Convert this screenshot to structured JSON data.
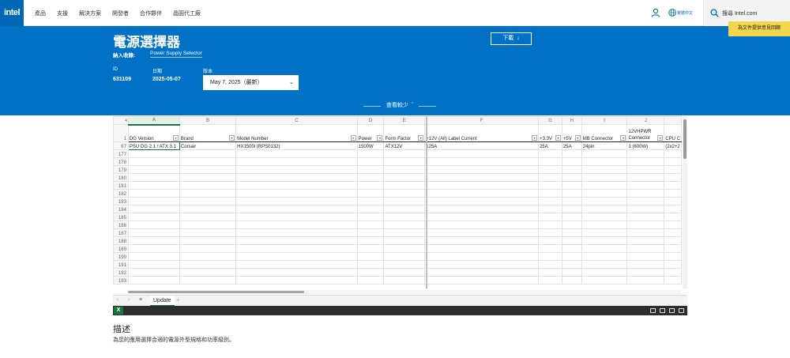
{
  "nav": {
    "logo": "intel",
    "links": [
      "產品",
      "支援",
      "解決方案",
      "開發者",
      "合作夥伴",
      "晶圓代工廠"
    ],
    "language": "繁體中文",
    "search_placeholder": "搜尋 Intel.com"
  },
  "hero": {
    "title": "電源選擇器",
    "included_label": "納入收錄:",
    "included_link": "Power Supply Selector",
    "id_label": "ID",
    "id_value": "631109",
    "date_label": "日期",
    "date_value": "2025-05-07",
    "version_label": "版本",
    "version_value": "May 7, 2025（最新）",
    "download_label": "下載",
    "feedback_label": "為文件提供意見回饋",
    "collapse_label": "查看較少"
  },
  "spreadsheet": {
    "corner": "4",
    "columns": [
      "A",
      "B",
      "C",
      "D",
      "E",
      "F",
      "G",
      "H",
      "I",
      "J",
      ""
    ],
    "header_row_number": "1",
    "headers": [
      "DG Version",
      "Brand",
      "Model Number",
      "Power",
      "Form Factor",
      "+12V (All) Label Current",
      "+3.3V",
      "+5V",
      "MB Connector",
      "12VHPWR Connector",
      "CPU C"
    ],
    "data_row_number": "67",
    "data_row": [
      "PSU DG 2.1 / ATX 3.1",
      "Corsair",
      "HX1500i (RPS0132)",
      "1500W",
      "ATX12V",
      "125A",
      "25A",
      "25A",
      "24pin",
      "1 (600W)",
      "(2x2+2"
    ],
    "empty_row_numbers": [
      "177",
      "178",
      "179",
      "180",
      "181",
      "182",
      "183",
      "184",
      "185",
      "186",
      "187",
      "188",
      "189",
      "190",
      "191",
      "192",
      "193"
    ],
    "sheet_tab": "Update",
    "excel_badge": "X"
  },
  "description": {
    "title": "描述",
    "text": "為您的應用選擇合適的電源外型規格和功率級別。"
  }
}
